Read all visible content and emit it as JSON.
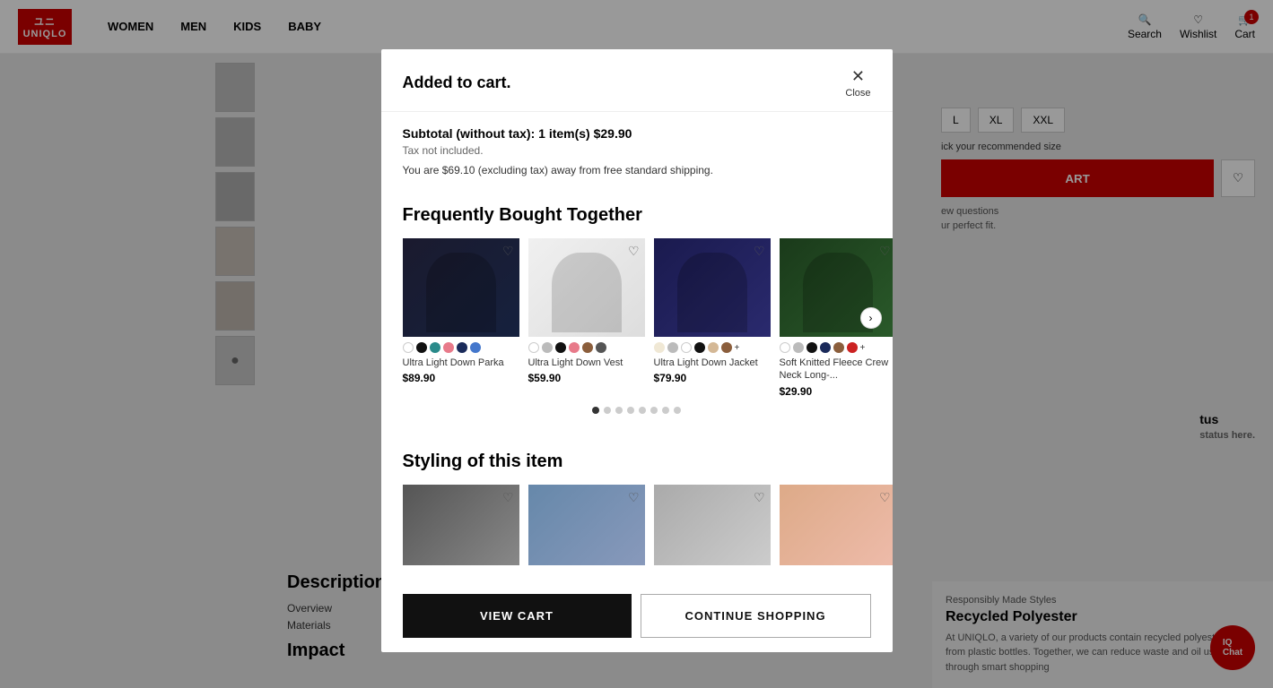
{
  "header": {
    "logo_line1": "ユニ",
    "logo_line2": "UNIQLO",
    "nav": [
      "WOMEN",
      "MEN",
      "KIDS",
      "BABY"
    ],
    "icons": {
      "search": "Search",
      "wishlist": "Wishlist",
      "cart": "Cart",
      "cart_count": "1"
    }
  },
  "modal": {
    "title": "Added to cart.",
    "close_label": "Close",
    "subtotal_text": "Subtotal (without tax): 1 item(s) $29.90",
    "tax_note": "Tax not included.",
    "shipping_note": "You are $69.10 (excluding tax) away from free standard shipping.",
    "sections": {
      "frequently_bought": "Frequently Bought Together",
      "styling": "Styling of this item"
    },
    "products": [
      {
        "name": "Ultra Light Down Parka",
        "price": "$89.90",
        "swatches": [
          "sw-white",
          "sw-black",
          "sw-teal",
          "sw-pink",
          "sw-navy",
          "sw-blue"
        ],
        "has_more": false,
        "bg": "pimg-1"
      },
      {
        "name": "Ultra Light Down Vest",
        "price": "$59.90",
        "swatches": [
          "sw-white",
          "sw-lgray",
          "sw-black",
          "sw-pink",
          "sw-brown",
          "sw-dgray"
        ],
        "has_more": false,
        "bg": "pimg-2"
      },
      {
        "name": "Ultra Light Down Jacket",
        "price": "$79.90",
        "swatches": [
          "sw-cream",
          "sw-lgray",
          "sw-white",
          "sw-black",
          "sw-beige",
          "sw-brown"
        ],
        "has_more": true,
        "bg": "pimg-3"
      },
      {
        "name": "Soft Knitted Fleece Crew Neck Long-...",
        "price": "$29.90",
        "swatches": [
          "sw-white",
          "sw-lgray",
          "sw-black",
          "sw-navy",
          "sw-brown",
          "sw-red"
        ],
        "has_more": true,
        "bg": "pimg-4"
      }
    ],
    "dots": [
      true,
      false,
      false,
      false,
      false,
      false,
      false,
      false
    ],
    "styling_items": [
      {
        "bg": "styling-1"
      },
      {
        "bg": "styling-2"
      },
      {
        "bg": "styling-3"
      },
      {
        "bg": "styling-4"
      }
    ],
    "buttons": {
      "view_cart": "VIEW CART",
      "continue_shopping": "CONTINUE SHOPPING"
    }
  },
  "background": {
    "description_title": "Description",
    "desc_links": [
      "Overview",
      "Materials"
    ],
    "impact_title": "Impact",
    "recycled_label": "Responsibly Made Styles",
    "recycled_title": "Recycled Polyester",
    "recycled_text": "At UNIQLO, a variety of our products contain recycled polyester made from plastic bottles. Together, we can reduce waste and oil usage through smart shopping"
  },
  "chat": {
    "label": "IQ",
    "sub": "Chat"
  }
}
